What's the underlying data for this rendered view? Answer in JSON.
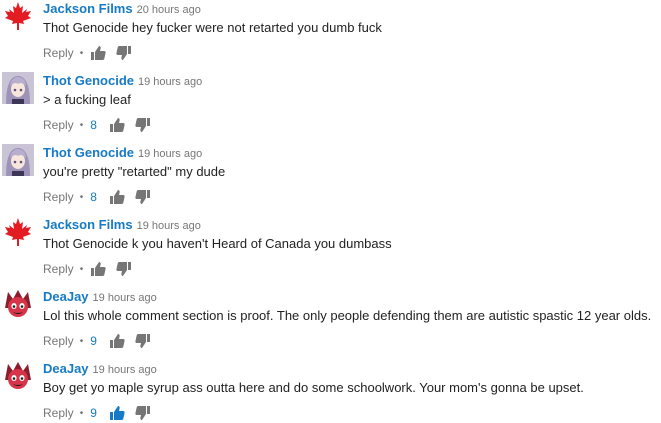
{
  "comments": [
    {
      "author": "Jackson Films",
      "time": "20 hours ago",
      "text": "Thot Genocide hey fucker were not retarted you dumb fuck",
      "reply_label": "Reply",
      "likes": "",
      "liked": false,
      "avatar": "maple-leaf"
    },
    {
      "author": "Thot Genocide",
      "time": "19 hours ago",
      "text": "> a fucking leaf",
      "reply_label": "Reply",
      "likes": "8",
      "liked": false,
      "avatar": "anime-girl"
    },
    {
      "author": "Thot Genocide",
      "time": "19 hours ago",
      "text": "you're pretty \"retarted\" my dude",
      "reply_label": "Reply",
      "likes": "8",
      "liked": false,
      "avatar": "anime-girl"
    },
    {
      "author": "Jackson Films",
      "time": "19 hours ago",
      "text": "Thot Genocide k you haven't Heard of Canada you dumbass",
      "reply_label": "Reply",
      "likes": "",
      "liked": false,
      "avatar": "maple-leaf"
    },
    {
      "author": "DeaJay",
      "time": "19 hours ago",
      "text": "Lol this whole comment section is proof. The only people defending them are autistic spastic 12 year olds.",
      "reply_label": "Reply",
      "likes": "9",
      "liked": false,
      "avatar": "red-character"
    },
    {
      "author": "DeaJay",
      "time": "19 hours ago",
      "text": "Boy get yo maple syrup ass outta here and do some schoolwork. Your mom's gonna be upset.",
      "reply_label": "Reply",
      "likes": "9",
      "liked": true,
      "avatar": "red-character"
    }
  ],
  "colors": {
    "author": "#167ac6",
    "like_active": "#167ac6",
    "icon_idle": "#767676",
    "maple_red": "#e31b23"
  }
}
